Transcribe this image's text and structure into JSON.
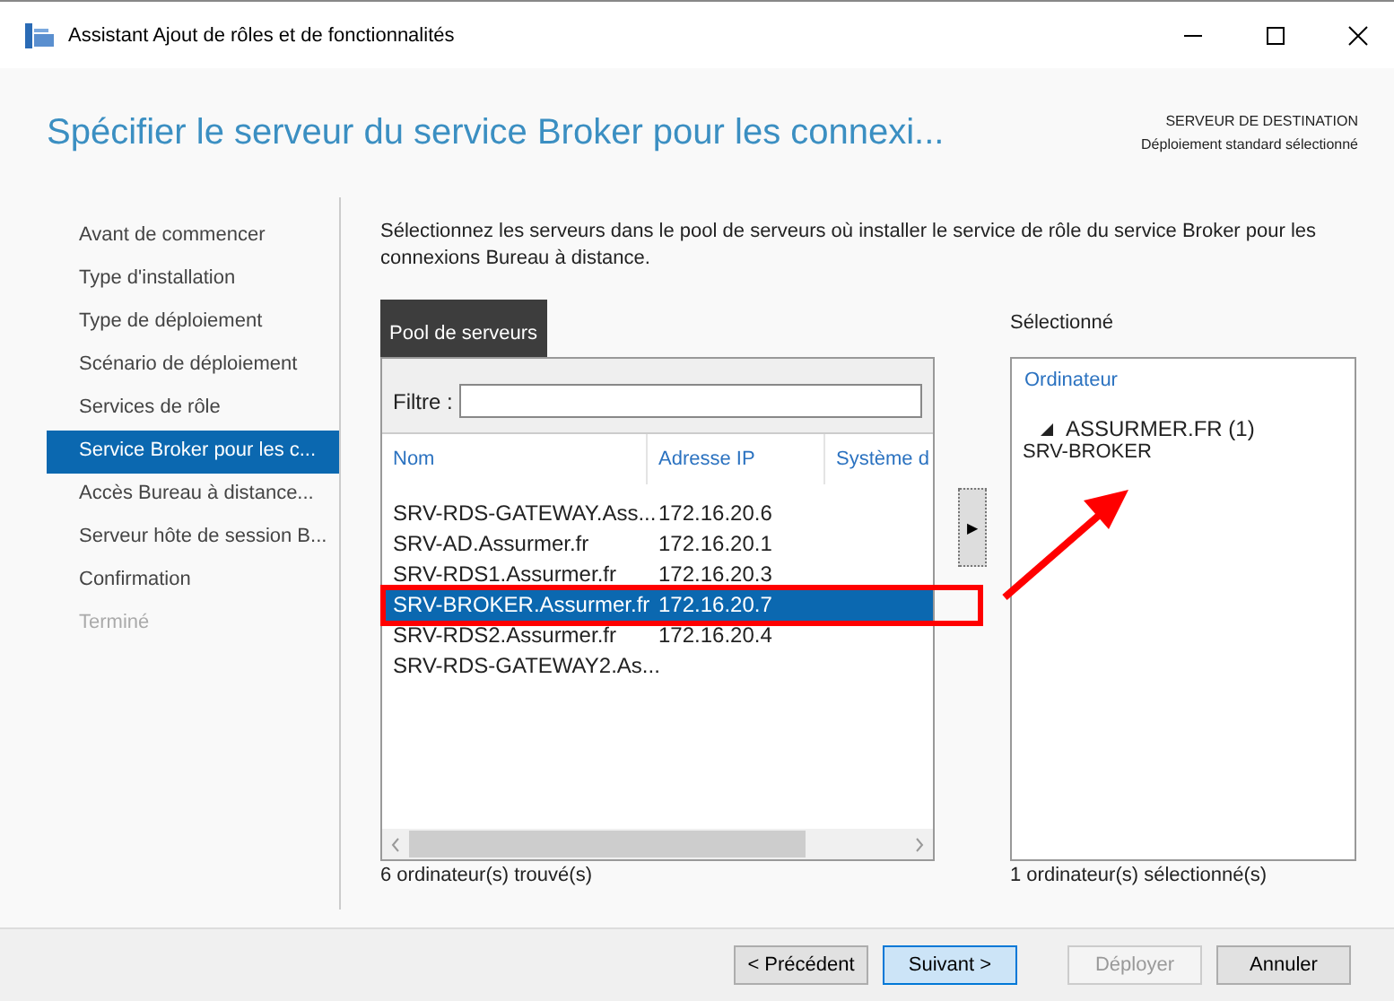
{
  "window": {
    "title": "Assistant Ajout de rôles et de fonctionnalités"
  },
  "header": {
    "title": "Spécifier le serveur du service Broker pour les connexi...",
    "destination_label": "SERVEUR DE DESTINATION",
    "destination_value": "Déploiement standard sélectionné"
  },
  "nav": [
    {
      "label": "Avant de commencer",
      "selected": false,
      "disabled": false
    },
    {
      "label": "Type d'installation",
      "selected": false,
      "disabled": false
    },
    {
      "label": "Type de déploiement",
      "selected": false,
      "disabled": false
    },
    {
      "label": "Scénario de déploiement",
      "selected": false,
      "disabled": false
    },
    {
      "label": "Services de rôle",
      "selected": false,
      "disabled": false
    },
    {
      "label": "Service Broker pour les c...",
      "selected": true,
      "disabled": false
    },
    {
      "label": "Accès Bureau à distance...",
      "selected": false,
      "disabled": false
    },
    {
      "label": "Serveur hôte de session B...",
      "selected": false,
      "disabled": false
    },
    {
      "label": "Confirmation",
      "selected": false,
      "disabled": false
    },
    {
      "label": "Terminé",
      "selected": false,
      "disabled": true
    }
  ],
  "description": "Sélectionnez les serveurs dans le pool de serveurs où installer le service de rôle du service Broker pour les connexions Bureau à distance.",
  "pool": {
    "tab": "Pool de serveurs",
    "filter_label": "Filtre :",
    "columns": [
      "Nom",
      "Adresse IP",
      "Système d"
    ],
    "rows": [
      {
        "name": "SRV-RDS-GATEWAY.Ass...",
        "ip": "172.16.20.6",
        "selected": false
      },
      {
        "name": "SRV-AD.Assurmer.fr",
        "ip": "172.16.20.1",
        "selected": false
      },
      {
        "name": "SRV-RDS1.Assurmer.fr",
        "ip": "172.16.20.3",
        "selected": false
      },
      {
        "name": "SRV-BROKER.Assurmer.fr",
        "ip": "172.16.20.7",
        "selected": true
      },
      {
        "name": "SRV-RDS2.Assurmer.fr",
        "ip": "172.16.20.4",
        "selected": false
      },
      {
        "name": "SRV-RDS-GATEWAY2.As...",
        "ip": "",
        "selected": false
      }
    ],
    "count": "6 ordinateur(s) trouvé(s)"
  },
  "add_button": "▶",
  "selected": {
    "label": "Sélectionné",
    "column": "Ordinateur",
    "group": {
      "label": "ASSURMER.FR (1)",
      "expanded": true,
      "items": [
        "SRV-BROKER"
      ]
    },
    "count": "1 ordinateur(s) sélectionné(s)"
  },
  "buttons": [
    {
      "label": "< Précédent",
      "kind": "normal"
    },
    {
      "label": "Suivant >",
      "kind": "primary"
    },
    {
      "label": "Déployer",
      "kind": "disabled"
    },
    {
      "label": "Annuler",
      "kind": "normal"
    }
  ]
}
